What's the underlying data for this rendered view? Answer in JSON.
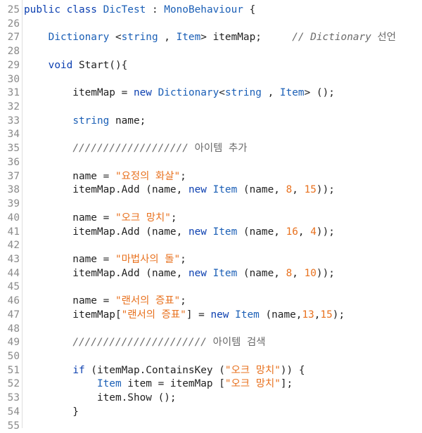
{
  "editor": {
    "lines": [
      {
        "n": "25",
        "tokens": [
          [
            "kw",
            "public class "
          ],
          [
            "ty",
            "DicTest"
          ],
          [
            "t",
            " : "
          ],
          [
            "ty",
            "MonoBehaviour"
          ],
          [
            "t",
            " {"
          ]
        ]
      },
      {
        "n": "26",
        "tokens": []
      },
      {
        "n": "27",
        "tokens": [
          [
            "t",
            "    "
          ],
          [
            "ty",
            "Dictionary"
          ],
          [
            "t",
            " <"
          ],
          [
            "ty",
            "string"
          ],
          [
            "t",
            " , "
          ],
          [
            "ty",
            "Item"
          ],
          [
            "t",
            "> itemMap;     "
          ],
          [
            "cm",
            "// Dictionary "
          ],
          [
            "cmk",
            "선언"
          ]
        ]
      },
      {
        "n": "28",
        "tokens": []
      },
      {
        "n": "29",
        "tokens": [
          [
            "t",
            "    "
          ],
          [
            "kw",
            "void"
          ],
          [
            "t",
            " Start(){"
          ]
        ]
      },
      {
        "n": "30",
        "tokens": []
      },
      {
        "n": "31",
        "tokens": [
          [
            "t",
            "        itemMap = "
          ],
          [
            "kw",
            "new"
          ],
          [
            "t",
            " "
          ],
          [
            "ty",
            "Dictionary"
          ],
          [
            "t",
            "<"
          ],
          [
            "ty",
            "string"
          ],
          [
            "t",
            " , "
          ],
          [
            "ty",
            "Item"
          ],
          [
            "t",
            "> ();"
          ]
        ]
      },
      {
        "n": "32",
        "tokens": []
      },
      {
        "n": "33",
        "tokens": [
          [
            "t",
            "        "
          ],
          [
            "ty",
            "string"
          ],
          [
            "t",
            " name;"
          ]
        ]
      },
      {
        "n": "34",
        "tokens": []
      },
      {
        "n": "35",
        "tokens": [
          [
            "t",
            "        "
          ],
          [
            "cm",
            "/////////////////// "
          ],
          [
            "cmk",
            "아이템 추가"
          ]
        ]
      },
      {
        "n": "36",
        "tokens": []
      },
      {
        "n": "37",
        "tokens": [
          [
            "t",
            "        name = "
          ],
          [
            "str",
            "\"요정의 화살\""
          ],
          [
            "t",
            ";"
          ]
        ]
      },
      {
        "n": "38",
        "tokens": [
          [
            "t",
            "        itemMap.Add (name, "
          ],
          [
            "kw",
            "new"
          ],
          [
            "t",
            " "
          ],
          [
            "ty",
            "Item"
          ],
          [
            "t",
            " (name, "
          ],
          [
            "num",
            "8"
          ],
          [
            "t",
            ", "
          ],
          [
            "num",
            "15"
          ],
          [
            "t",
            "));"
          ]
        ]
      },
      {
        "n": "39",
        "tokens": []
      },
      {
        "n": "40",
        "tokens": [
          [
            "t",
            "        name = "
          ],
          [
            "str",
            "\"오크 망치\""
          ],
          [
            "t",
            ";"
          ]
        ]
      },
      {
        "n": "41",
        "tokens": [
          [
            "t",
            "        itemMap.Add (name, "
          ],
          [
            "kw",
            "new"
          ],
          [
            "t",
            " "
          ],
          [
            "ty",
            "Item"
          ],
          [
            "t",
            " (name, "
          ],
          [
            "num",
            "16"
          ],
          [
            "t",
            ", "
          ],
          [
            "num",
            "4"
          ],
          [
            "t",
            "));"
          ]
        ]
      },
      {
        "n": "42",
        "tokens": []
      },
      {
        "n": "43",
        "tokens": [
          [
            "t",
            "        name = "
          ],
          [
            "str",
            "\"마법사의 돌\""
          ],
          [
            "t",
            ";"
          ]
        ]
      },
      {
        "n": "44",
        "tokens": [
          [
            "t",
            "        itemMap.Add (name, "
          ],
          [
            "kw",
            "new"
          ],
          [
            "t",
            " "
          ],
          [
            "ty",
            "Item"
          ],
          [
            "t",
            " (name, "
          ],
          [
            "num",
            "8"
          ],
          [
            "t",
            ", "
          ],
          [
            "num",
            "10"
          ],
          [
            "t",
            "));"
          ]
        ]
      },
      {
        "n": "45",
        "tokens": []
      },
      {
        "n": "46",
        "tokens": [
          [
            "t",
            "        name = "
          ],
          [
            "str",
            "\"랜서의 증표\""
          ],
          [
            "t",
            ";"
          ]
        ]
      },
      {
        "n": "47",
        "tokens": [
          [
            "t",
            "        itemMap["
          ],
          [
            "str",
            "\"랜서의 증표\""
          ],
          [
            "t",
            "] = "
          ],
          [
            "kw",
            "new"
          ],
          [
            "t",
            " "
          ],
          [
            "ty",
            "Item"
          ],
          [
            "t",
            " (name,"
          ],
          [
            "num",
            "13"
          ],
          [
            "t",
            ","
          ],
          [
            "num",
            "15"
          ],
          [
            "t",
            ");"
          ]
        ]
      },
      {
        "n": "48",
        "tokens": []
      },
      {
        "n": "49",
        "tokens": [
          [
            "t",
            "        "
          ],
          [
            "cm",
            "////////////////////// "
          ],
          [
            "cmk",
            "아이템 검색"
          ]
        ]
      },
      {
        "n": "50",
        "tokens": []
      },
      {
        "n": "51",
        "tokens": [
          [
            "t",
            "        "
          ],
          [
            "kw",
            "if"
          ],
          [
            "t",
            " (itemMap.ContainsKey ("
          ],
          [
            "str",
            "\"오크 망치\""
          ],
          [
            "t",
            ")) {"
          ]
        ]
      },
      {
        "n": "52",
        "tokens": [
          [
            "t",
            "            "
          ],
          [
            "ty",
            "Item"
          ],
          [
            "t",
            " item = itemMap ["
          ],
          [
            "str",
            "\"오크 망치\""
          ],
          [
            "t",
            "];"
          ]
        ]
      },
      {
        "n": "53",
        "tokens": [
          [
            "t",
            "            item.Show ();"
          ]
        ]
      },
      {
        "n": "54",
        "tokens": [
          [
            "t",
            "        }"
          ]
        ]
      },
      {
        "n": "55",
        "tokens": []
      }
    ]
  },
  "colors": {
    "keyword": "#0b3fb0",
    "type": "#1b5fb6",
    "string": "#e8711e",
    "number": "#e8711e",
    "comment": "#6a6a6a",
    "line_number": "#8a8a8a",
    "text": "#222222"
  }
}
